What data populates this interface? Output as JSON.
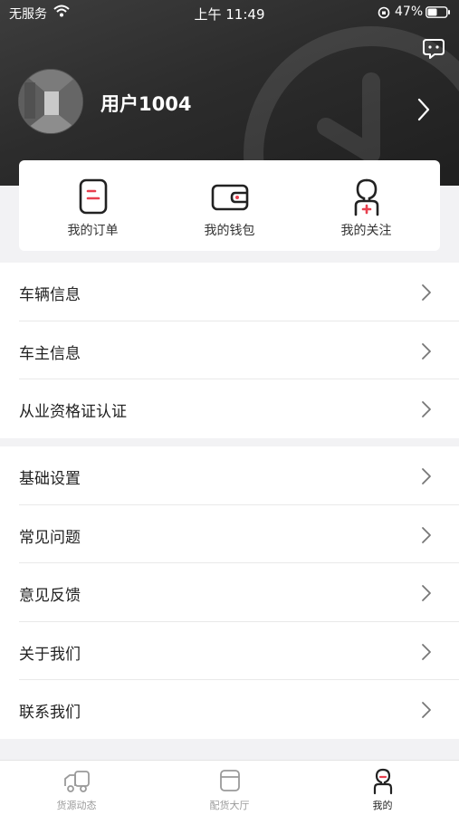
{
  "status_bar": {
    "carrier": "无服务",
    "time": "上午 11:49",
    "battery": "47%"
  },
  "profile": {
    "username": "用户1004"
  },
  "quick_actions": [
    {
      "label": "我的订单",
      "icon": "order-icon"
    },
    {
      "label": "我的钱包",
      "icon": "wallet-icon"
    },
    {
      "label": "我的关注",
      "icon": "follow-icon"
    }
  ],
  "menu_group_1": [
    {
      "label": "车辆信息"
    },
    {
      "label": "车主信息"
    },
    {
      "label": "从业资格证认证"
    }
  ],
  "menu_group_2": [
    {
      "label": "基础设置"
    },
    {
      "label": "常见问题"
    },
    {
      "label": "意见反馈"
    },
    {
      "label": "关于我们"
    },
    {
      "label": "联系我们"
    }
  ],
  "tabbar": [
    {
      "label": "货源动态",
      "icon": "truck-icon",
      "active": false
    },
    {
      "label": "配货大厅",
      "icon": "hall-icon",
      "active": false
    },
    {
      "label": "我的",
      "icon": "person-icon",
      "active": true
    }
  ],
  "colors": {
    "accent": "#e8404f",
    "header_dark": "#2c2c2c",
    "text": "#222222",
    "inactive": "#9a9a9a"
  }
}
